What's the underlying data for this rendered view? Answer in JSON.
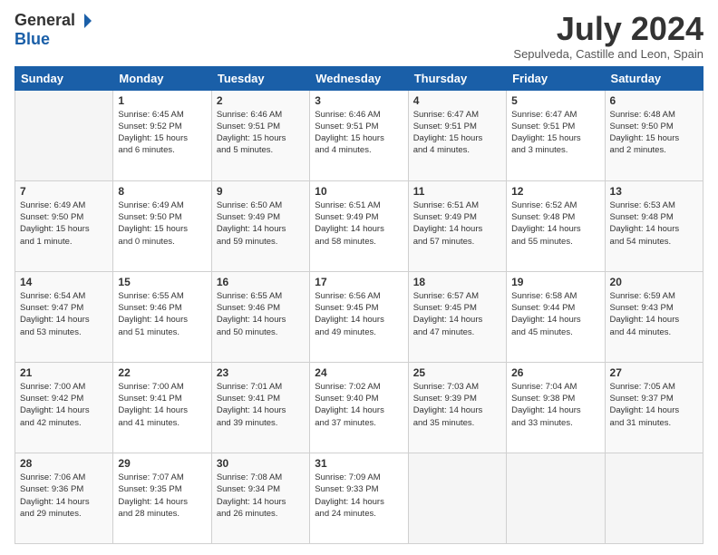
{
  "header": {
    "logo": {
      "general": "General",
      "blue": "Blue"
    },
    "title": "July 2024",
    "subtitle": "Sepulveda, Castille and Leon, Spain"
  },
  "calendar": {
    "headers": [
      "Sunday",
      "Monday",
      "Tuesday",
      "Wednesday",
      "Thursday",
      "Friday",
      "Saturday"
    ],
    "weeks": [
      [
        {
          "day": "",
          "info": ""
        },
        {
          "day": "1",
          "info": "Sunrise: 6:45 AM\nSunset: 9:52 PM\nDaylight: 15 hours\nand 6 minutes."
        },
        {
          "day": "2",
          "info": "Sunrise: 6:46 AM\nSunset: 9:51 PM\nDaylight: 15 hours\nand 5 minutes."
        },
        {
          "day": "3",
          "info": "Sunrise: 6:46 AM\nSunset: 9:51 PM\nDaylight: 15 hours\nand 4 minutes."
        },
        {
          "day": "4",
          "info": "Sunrise: 6:47 AM\nSunset: 9:51 PM\nDaylight: 15 hours\nand 4 minutes."
        },
        {
          "day": "5",
          "info": "Sunrise: 6:47 AM\nSunset: 9:51 PM\nDaylight: 15 hours\nand 3 minutes."
        },
        {
          "day": "6",
          "info": "Sunrise: 6:48 AM\nSunset: 9:50 PM\nDaylight: 15 hours\nand 2 minutes."
        }
      ],
      [
        {
          "day": "7",
          "info": "Sunrise: 6:49 AM\nSunset: 9:50 PM\nDaylight: 15 hours\nand 1 minute."
        },
        {
          "day": "8",
          "info": "Sunrise: 6:49 AM\nSunset: 9:50 PM\nDaylight: 15 hours\nand 0 minutes."
        },
        {
          "day": "9",
          "info": "Sunrise: 6:50 AM\nSunset: 9:49 PM\nDaylight: 14 hours\nand 59 minutes."
        },
        {
          "day": "10",
          "info": "Sunrise: 6:51 AM\nSunset: 9:49 PM\nDaylight: 14 hours\nand 58 minutes."
        },
        {
          "day": "11",
          "info": "Sunrise: 6:51 AM\nSunset: 9:49 PM\nDaylight: 14 hours\nand 57 minutes."
        },
        {
          "day": "12",
          "info": "Sunrise: 6:52 AM\nSunset: 9:48 PM\nDaylight: 14 hours\nand 55 minutes."
        },
        {
          "day": "13",
          "info": "Sunrise: 6:53 AM\nSunset: 9:48 PM\nDaylight: 14 hours\nand 54 minutes."
        }
      ],
      [
        {
          "day": "14",
          "info": "Sunrise: 6:54 AM\nSunset: 9:47 PM\nDaylight: 14 hours\nand 53 minutes."
        },
        {
          "day": "15",
          "info": "Sunrise: 6:55 AM\nSunset: 9:46 PM\nDaylight: 14 hours\nand 51 minutes."
        },
        {
          "day": "16",
          "info": "Sunrise: 6:55 AM\nSunset: 9:46 PM\nDaylight: 14 hours\nand 50 minutes."
        },
        {
          "day": "17",
          "info": "Sunrise: 6:56 AM\nSunset: 9:45 PM\nDaylight: 14 hours\nand 49 minutes."
        },
        {
          "day": "18",
          "info": "Sunrise: 6:57 AM\nSunset: 9:45 PM\nDaylight: 14 hours\nand 47 minutes."
        },
        {
          "day": "19",
          "info": "Sunrise: 6:58 AM\nSunset: 9:44 PM\nDaylight: 14 hours\nand 45 minutes."
        },
        {
          "day": "20",
          "info": "Sunrise: 6:59 AM\nSunset: 9:43 PM\nDaylight: 14 hours\nand 44 minutes."
        }
      ],
      [
        {
          "day": "21",
          "info": "Sunrise: 7:00 AM\nSunset: 9:42 PM\nDaylight: 14 hours\nand 42 minutes."
        },
        {
          "day": "22",
          "info": "Sunrise: 7:00 AM\nSunset: 9:41 PM\nDaylight: 14 hours\nand 41 minutes."
        },
        {
          "day": "23",
          "info": "Sunrise: 7:01 AM\nSunset: 9:41 PM\nDaylight: 14 hours\nand 39 minutes."
        },
        {
          "day": "24",
          "info": "Sunrise: 7:02 AM\nSunset: 9:40 PM\nDaylight: 14 hours\nand 37 minutes."
        },
        {
          "day": "25",
          "info": "Sunrise: 7:03 AM\nSunset: 9:39 PM\nDaylight: 14 hours\nand 35 minutes."
        },
        {
          "day": "26",
          "info": "Sunrise: 7:04 AM\nSunset: 9:38 PM\nDaylight: 14 hours\nand 33 minutes."
        },
        {
          "day": "27",
          "info": "Sunrise: 7:05 AM\nSunset: 9:37 PM\nDaylight: 14 hours\nand 31 minutes."
        }
      ],
      [
        {
          "day": "28",
          "info": "Sunrise: 7:06 AM\nSunset: 9:36 PM\nDaylight: 14 hours\nand 29 minutes."
        },
        {
          "day": "29",
          "info": "Sunrise: 7:07 AM\nSunset: 9:35 PM\nDaylight: 14 hours\nand 28 minutes."
        },
        {
          "day": "30",
          "info": "Sunrise: 7:08 AM\nSunset: 9:34 PM\nDaylight: 14 hours\nand 26 minutes."
        },
        {
          "day": "31",
          "info": "Sunrise: 7:09 AM\nSunset: 9:33 PM\nDaylight: 14 hours\nand 24 minutes."
        },
        {
          "day": "",
          "info": ""
        },
        {
          "day": "",
          "info": ""
        },
        {
          "day": "",
          "info": ""
        }
      ]
    ]
  }
}
